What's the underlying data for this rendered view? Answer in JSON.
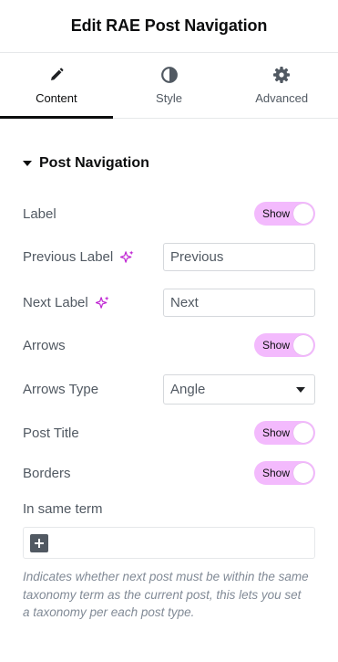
{
  "header": {
    "title": "Edit RAE Post Navigation"
  },
  "tabs": [
    {
      "label": "Content",
      "icon": "pencil-icon",
      "active": true
    },
    {
      "label": "Style",
      "icon": "half-circle-icon",
      "active": false
    },
    {
      "label": "Advanced",
      "icon": "gear-icon",
      "active": false
    }
  ],
  "section": {
    "title": "Post Navigation",
    "expanded": true
  },
  "fields": {
    "label": {
      "label": "Label",
      "toggle": "Show",
      "on": true
    },
    "previous_label": {
      "label": "Previous Label",
      "value": "Previous",
      "icon": "ai-sparkle-icon"
    },
    "next_label": {
      "label": "Next Label",
      "value": "Next",
      "icon": "ai-sparkle-icon"
    },
    "arrows": {
      "label": "Arrows",
      "toggle": "Show",
      "on": true
    },
    "arrows_type": {
      "label": "Arrows Type",
      "value": "Angle"
    },
    "post_title": {
      "label": "Post Title",
      "toggle": "Show",
      "on": true
    },
    "borders": {
      "label": "Borders",
      "toggle": "Show",
      "on": true
    },
    "in_same_term": {
      "label": "In same term",
      "help": "Indicates whether next post must be within the same taxonomy term as the current post, this lets you set a taxonomy per each post type."
    }
  },
  "colors": {
    "toggle_on": "#f3bafd",
    "sparkle": "#c026d3",
    "text": "#515962",
    "title": "#0c0d0e"
  }
}
